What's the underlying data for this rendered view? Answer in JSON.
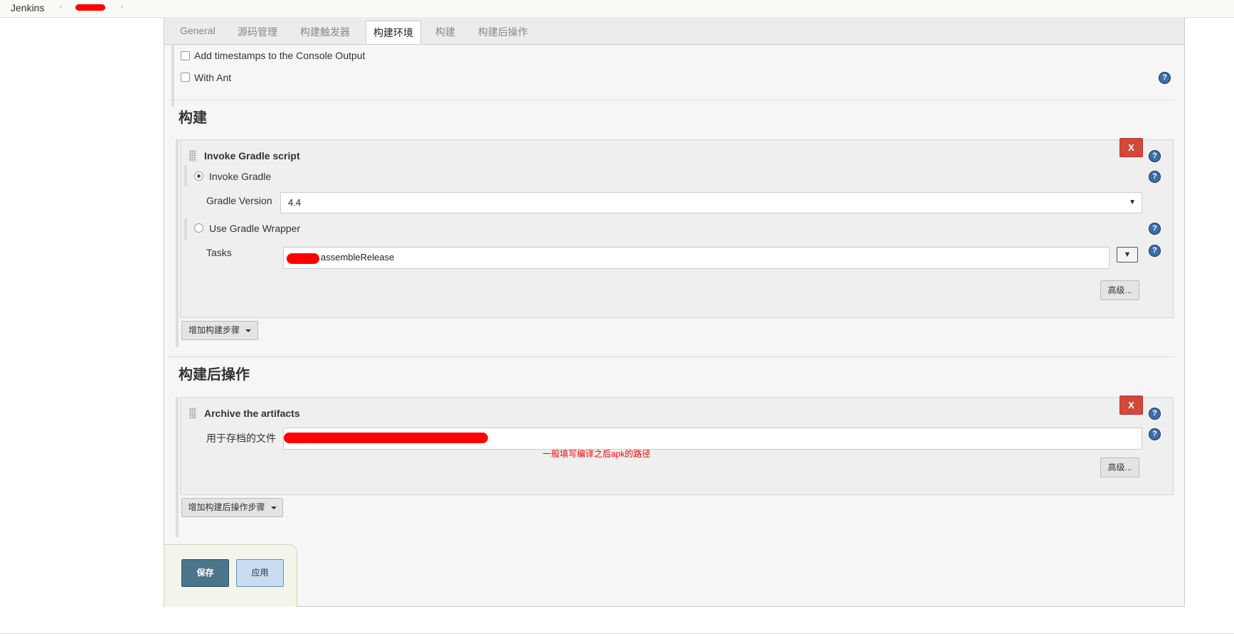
{
  "breadcrumb": {
    "root": "Jenkins",
    "sep": "›"
  },
  "tabs": [
    "General",
    "源码管理",
    "构建触发器",
    "构建环境",
    "构建",
    "构建后操作"
  ],
  "env": {
    "timestamps_label": "Add timestamps to the Console Output",
    "ant_label": "With Ant"
  },
  "build": {
    "title": "构建",
    "step_title": "Invoke Gradle script",
    "remove_label": "X",
    "invoke_gradle_label": "Invoke Gradle",
    "gradle_version_label": "Gradle Version",
    "gradle_version_value": "4.4",
    "wrapper_label": "Use Gradle Wrapper",
    "tasks_label": "Tasks",
    "tasks_value": "assembleRelease",
    "tasks_dropdown": "▼",
    "advanced_label": "高级...",
    "add_step_label": "增加构建步骤"
  },
  "post": {
    "title": "构建后操作",
    "step_title": "Archive the artifacts",
    "remove_label": "X",
    "files_label": "用于存档的文件",
    "annotation": "一般填写编译之后apk的路径",
    "advanced_label": "高级...",
    "add_step_label": "增加构建后操作步骤"
  },
  "footer": {
    "save_label": "保存",
    "apply_label": "应用"
  },
  "help_glyph": "?",
  "colors": {
    "remove": "#d24939",
    "save": "#4b758b",
    "annotation": "#ff0000",
    "help": "#3a6fb0"
  }
}
